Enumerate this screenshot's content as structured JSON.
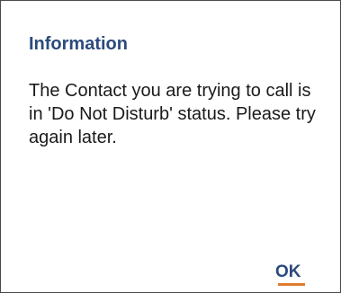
{
  "dialog": {
    "title": "Information",
    "message": "The Contact you are trying to call is in 'Do Not Disturb' status. Please try again later.",
    "ok_label": "OK"
  },
  "colors": {
    "title": "#2c4a7e",
    "text": "#1a1a1a",
    "accent_underline": "#e07a2f",
    "border": "#4a4a4a"
  }
}
